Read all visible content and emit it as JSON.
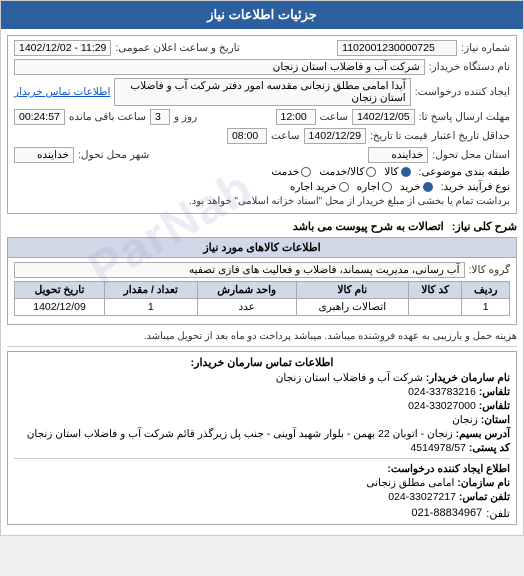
{
  "header": {
    "title": "جزئیات اطلاعات نیاز"
  },
  "order_info": {
    "order_number_label": "شماره نیاز:",
    "order_number_value": "1102001230000725",
    "date_time_label": "تاریخ و ساعت اعلان عمومی:",
    "date_time_value": "1402/12/02 - 11:29",
    "buyer_label": "نام دستگاه خریدار:",
    "buyer_value": "شرکت آب و فاضلاب استان زنجان",
    "request_label": "ایجاد کننده درخواست:",
    "request_value": "آیدا امامی مطلق زنجانی مقدسه امور دفتر شرکت آب و فاضلاب استان زنجان",
    "contact_link": "اطلاعات تماس خریدار",
    "send_deadline_label": "مهلت ارسال پاسخ تا:",
    "send_date": "1402/12/05",
    "send_time_label": "ساعت",
    "send_time": "12:00",
    "day_label": "روز و",
    "days_value": "3",
    "remaining_label": "ساعت باقی مانده",
    "remaining_value": "00:24:57",
    "credit_label": "حداقل تاریخ اعتبار",
    "credit_sub": "قیمت تا تاریخ:",
    "credit_date": "1402/12/29",
    "credit_time_label": "ساعت",
    "credit_time": "08:00",
    "delivery_label": "استان محل تحول:",
    "delivery_value": "خداینده",
    "city_label": "شهر محل تحول:",
    "city_value": "خداینده",
    "category_label": "طبقه بندی موضوعی:",
    "category_options": [
      "کالا",
      "کالا/خدمت",
      "خدمت"
    ],
    "category_selected": "کالا",
    "purchase_type_label": "نوع فرآیند خرید:",
    "purchase_options": [
      "خرید",
      "اجاره",
      "خرید اجاره"
    ],
    "purchase_selected": "خرید",
    "purchase_note": "برداشت تمام یا بخشی از مبلغ خریدار از محل \"اسناد خزانه اسلامی\" خواهد بود."
  },
  "keywords": {
    "title": "شرح کلی نیاز:",
    "value": "اتصالات به شرح پیوست می باشد"
  },
  "goods_info": {
    "title": "اطلاعات کالاهای مورد نیاز",
    "group_label": "گروه کالا:",
    "group_value": "آب رسانی، مدیریت پسماند، فاضلاب و فعالیت های فازی تصفیه",
    "table": {
      "headers": [
        "ردیف",
        "کد کالا",
        "نام کالا",
        "واحد شمارش",
        "تعداد / مقدار",
        "تاریخ تحویل"
      ],
      "rows": [
        [
          "1",
          "عدد",
          "اتصالات راهبری",
          "1",
          "1402/12/09",
          ""
        ]
      ]
    }
  },
  "buyer_note": {
    "text": "هزینه حمل و بارزیبی به عهده فروشنده میباشد. میباشد پرداخت دو ماه بعد از تحویل میباشد."
  },
  "contact_info": {
    "title": "اطلاعات تماس سارمان خریدار:",
    "org_label": "نام سارمان خریدار:",
    "org_value": "شرکت آب و فاضلاب استان زنجان",
    "tel1_label": "تلفاس:",
    "tel1_value": "33783216-024",
    "tel2_label": "تلفاس:",
    "tel2_value": "33027000-024",
    "province_label": "استان:",
    "province_value": "زنجان",
    "address_label": "آدرس بسیم:",
    "address_value": "زنجان - اتوبان 22 بهمن - بلوار شهید آوینی - جنب پل زیرگذر قائم شرکت آب و فاضلاب استان زنجان",
    "postal_label": "کد پستی:",
    "postal_value": "4514978/57",
    "creator_label": "اطلاع ایجاد کننده درخواست:",
    "creator_name_label": "نام سازمان:",
    "creator_name_value": "امامی مطلق زنجانی",
    "creator_tel_label": "تلفن تماس:",
    "creator_tel_value": "33027217-024",
    "phone_label": "تلفن:",
    "phone_value": "021-88834967"
  },
  "watermark": "ParNab"
}
